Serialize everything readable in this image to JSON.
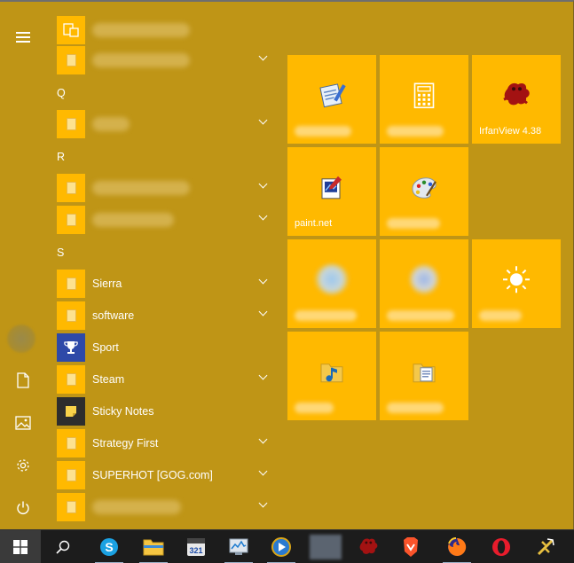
{
  "colors": {
    "accent": "#ffb900",
    "menu_bg": "#bf9516",
    "taskbar_bg": "#1c1c1c"
  },
  "rail": {
    "items": [
      {
        "icon": "hamburger-menu-icon"
      },
      {
        "icon": "user-avatar"
      },
      {
        "icon": "document-icon"
      },
      {
        "icon": "pictures-icon"
      },
      {
        "icon": "settings-gear-icon"
      },
      {
        "icon": "power-icon"
      }
    ]
  },
  "app_list": {
    "letters": {
      "q": "Q",
      "r": "R",
      "s": "S"
    },
    "rows": [
      {
        "label": "",
        "redacted": true,
        "icon": "laptop-icon",
        "chevron": false
      },
      {
        "label": "",
        "redacted": true,
        "icon": "folder-icon",
        "chevron": true
      },
      {
        "label": "",
        "redacted": true,
        "icon": "folder-icon",
        "chevron": true
      },
      {
        "label": "",
        "redacted": true,
        "icon": "folder-icon",
        "chevron": true
      },
      {
        "label": "",
        "redacted": true,
        "icon": "folder-icon",
        "chevron": true
      },
      {
        "label": "Sierra",
        "icon": "folder-icon",
        "chevron": true
      },
      {
        "label": "software",
        "icon": "folder-icon",
        "chevron": true
      },
      {
        "label": "Sport",
        "icon": "trophy-icon",
        "chevron": false
      },
      {
        "label": "Steam",
        "icon": "folder-icon",
        "chevron": true
      },
      {
        "label": "Sticky Notes",
        "icon": "sticky-notes-icon",
        "chevron": false
      },
      {
        "label": "Strategy First",
        "icon": "folder-icon",
        "chevron": true
      },
      {
        "label": "SUPERHOT [GOG.com]",
        "icon": "folder-icon",
        "chevron": true
      },
      {
        "label": "",
        "redacted": true,
        "icon": "folder-icon",
        "chevron": true
      }
    ]
  },
  "tiles": [
    {
      "label": "",
      "redacted": true,
      "icon": "notepad-app-icon"
    },
    {
      "label": "",
      "redacted": true,
      "icon": "calculator-icon"
    },
    {
      "label": "IrfanView 4.38",
      "icon": "irfanview-icon"
    },
    {
      "label": "paint.net",
      "icon": "paintnet-icon"
    },
    {
      "label": "",
      "redacted": true,
      "icon": "paint-palette-icon"
    },
    {
      "label": "",
      "redacted": true,
      "icon": "blurred-app-icon"
    },
    {
      "label": "",
      "redacted": true,
      "icon": "blurred-app-icon"
    },
    {
      "label": "",
      "redacted": true,
      "icon": "weather-sun-icon"
    },
    {
      "label": "",
      "redacted": true,
      "icon": "music-folder-icon"
    },
    {
      "label": "",
      "redacted": true,
      "icon": "documents-folder-icon"
    }
  ],
  "taskbar": {
    "items": [
      {
        "icon": "windows-start-icon"
      },
      {
        "icon": "search-icon"
      },
      {
        "icon": "skype-icon"
      },
      {
        "icon": "file-explorer-icon"
      },
      {
        "icon": "calendar-321-icon"
      },
      {
        "icon": "task-manager-icon"
      },
      {
        "icon": "media-player-icon"
      },
      {
        "icon": "blurred-app-icon"
      },
      {
        "icon": "irfanview-icon"
      },
      {
        "icon": "brave-browser-icon"
      },
      {
        "icon": "firefox-icon"
      },
      {
        "icon": "opera-icon"
      },
      {
        "icon": "winamp-icon"
      }
    ]
  }
}
